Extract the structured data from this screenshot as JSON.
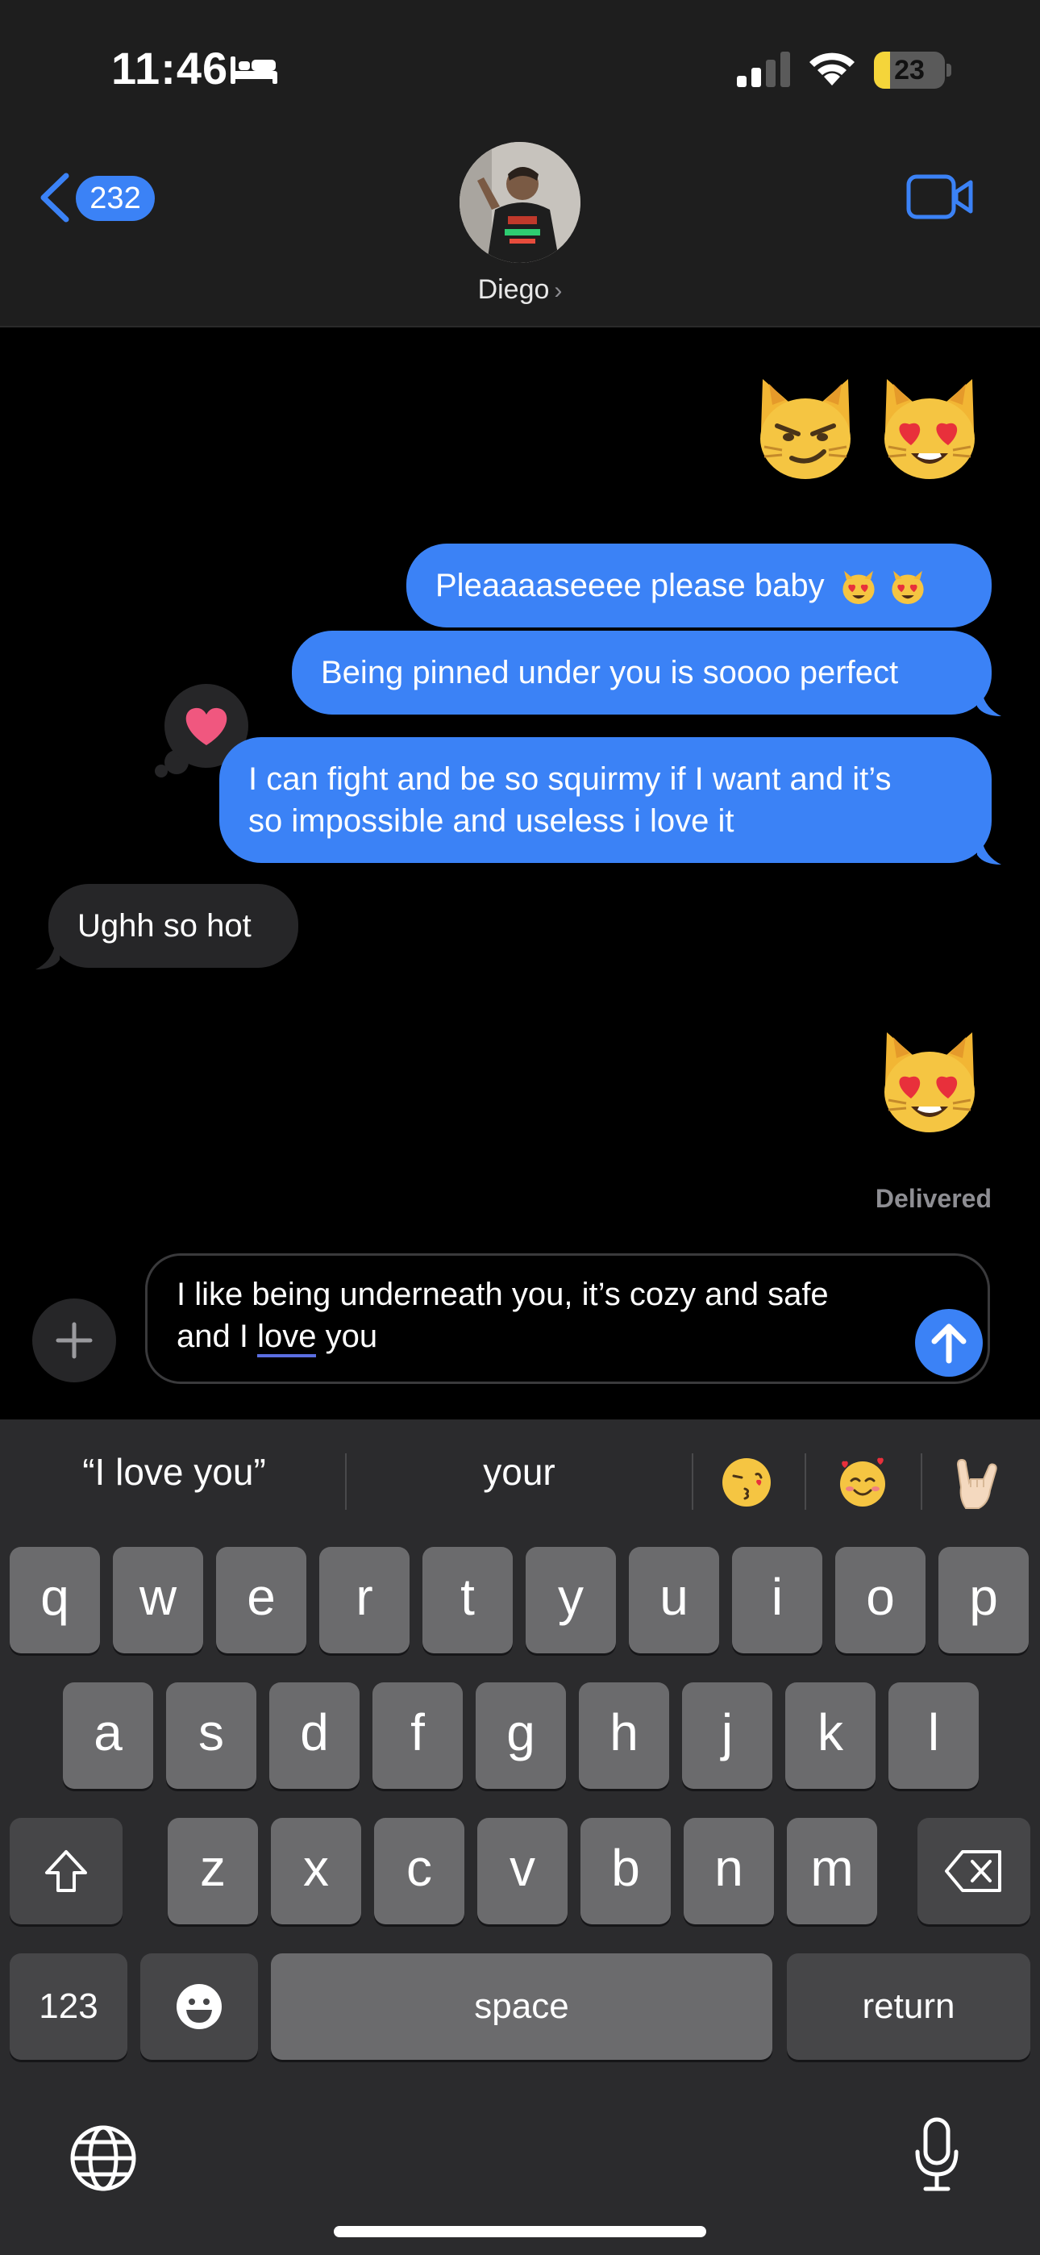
{
  "status": {
    "time": "11:46",
    "battery_level": "23",
    "battery_fraction": 0.23
  },
  "header": {
    "back_count": "232",
    "contact_name": "Diego",
    "contact_chevron": "›"
  },
  "messages": {
    "bubble1": "Pleaaaaseeee please baby",
    "bubble2": "Being pinned under you is soooo perfect",
    "bubble3_line1": "I can fight and be so squirmy if I want and it’s",
    "bubble3_line2": "so impossible and useless i love it",
    "received1": "Ughh so hot",
    "delivered": "Delivered"
  },
  "composer": {
    "line1": "I like being underneath you, it’s cozy and safe",
    "line2_pre": "and I ",
    "line2_word": "love",
    "line2_post": " you"
  },
  "keyboard": {
    "suggestions": [
      "“I love you”",
      "your"
    ],
    "row1": [
      "q",
      "w",
      "e",
      "r",
      "t",
      "y",
      "u",
      "i",
      "o",
      "p"
    ],
    "row2": [
      "a",
      "s",
      "d",
      "f",
      "g",
      "h",
      "j",
      "k",
      "l"
    ],
    "row3": [
      "z",
      "x",
      "c",
      "v",
      "b",
      "n",
      "m"
    ],
    "numbers_label": "123",
    "space_label": "space",
    "return_label": "return"
  },
  "colors": {
    "sent_bubble": "#3b82f6",
    "received_bubble": "#262628",
    "accent": "#3b82f6"
  },
  "icons": [
    "bed-icon",
    "signal-icon",
    "wifi-icon",
    "battery-icon",
    "back-chevron-icon",
    "video-icon",
    "heart-icon",
    "plus-icon",
    "send-arrow-icon",
    "shift-icon",
    "delete-icon",
    "emoji-icon",
    "globe-icon",
    "mic-icon"
  ]
}
